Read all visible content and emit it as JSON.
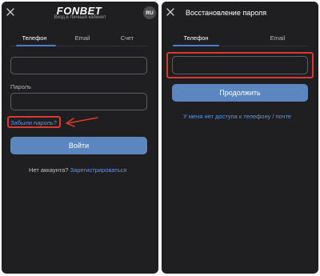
{
  "left": {
    "logo": "FONBET",
    "subtitle": "Вход в Личный кабинет",
    "lang": "RU",
    "tabs": [
      "Телефон",
      "Email",
      "Счет"
    ],
    "password_label": "Пароль",
    "forgot_link": "Забыли пароль?",
    "login_button": "Войти",
    "no_account_text": "Нет аккаунта?",
    "register_link": "Зарегистрироваться"
  },
  "right": {
    "title": "Восстановление пароля",
    "tabs": [
      "Телефон",
      "Email"
    ],
    "continue_button": "Продолжить",
    "no_access_link": "У меня нет доступа к телефону / почте"
  },
  "colors": {
    "panel_bg": "#1f1f21",
    "accent_blue": "#5b86c0",
    "link_blue": "#5e94e6",
    "highlight_red": "#d83a2b"
  }
}
